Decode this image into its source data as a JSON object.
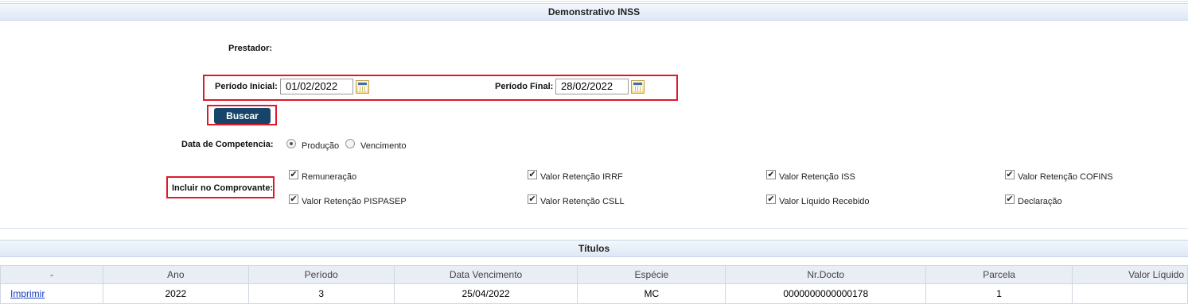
{
  "header": {
    "title": "Demonstrativo INSS"
  },
  "form": {
    "prestador_label": "Prestador:",
    "periodo_inicial_label": "Período Inicial:",
    "periodo_inicial_value": "01/02/2022",
    "periodo_final_label": "Período Final:",
    "periodo_final_value": "28/02/2022",
    "buscar_label": "Buscar",
    "competencia_label": "Data de Competencia:",
    "competencia_options": [
      {
        "label": "Produção",
        "selected": true
      },
      {
        "label": "Vencimento",
        "selected": false
      }
    ],
    "incluir_label": "Incluir no Comprovante:",
    "incluir_options": [
      {
        "label": "Remuneração",
        "checked": true
      },
      {
        "label": "Valor Retenção IRRF",
        "checked": true
      },
      {
        "label": "Valor Retenção ISS",
        "checked": true
      },
      {
        "label": "Valor Retenção COFINS",
        "checked": true
      },
      {
        "label": "Valor Retenção PISPASEP",
        "checked": true
      },
      {
        "label": "Valor Retenção CSLL",
        "checked": true
      },
      {
        "label": "Valor Líquido Recebido",
        "checked": true
      },
      {
        "label": "Declaração",
        "checked": true
      }
    ]
  },
  "titulos": {
    "title": "Títulos",
    "columns": [
      "-",
      "Ano",
      "Período",
      "Data Vencimento",
      "Espécie",
      "Nr.Docto",
      "Parcela",
      "Valor Líquido"
    ],
    "rows": [
      {
        "action": "Imprimir",
        "ano": "2022",
        "periodo": "3",
        "vencimento": "25/04/2022",
        "especie": "MC",
        "docto": "0000000000000178",
        "parcela": "1",
        "valor": ""
      }
    ]
  },
  "icons": {
    "calendar": "calendar-icon",
    "check": "checkmark"
  }
}
